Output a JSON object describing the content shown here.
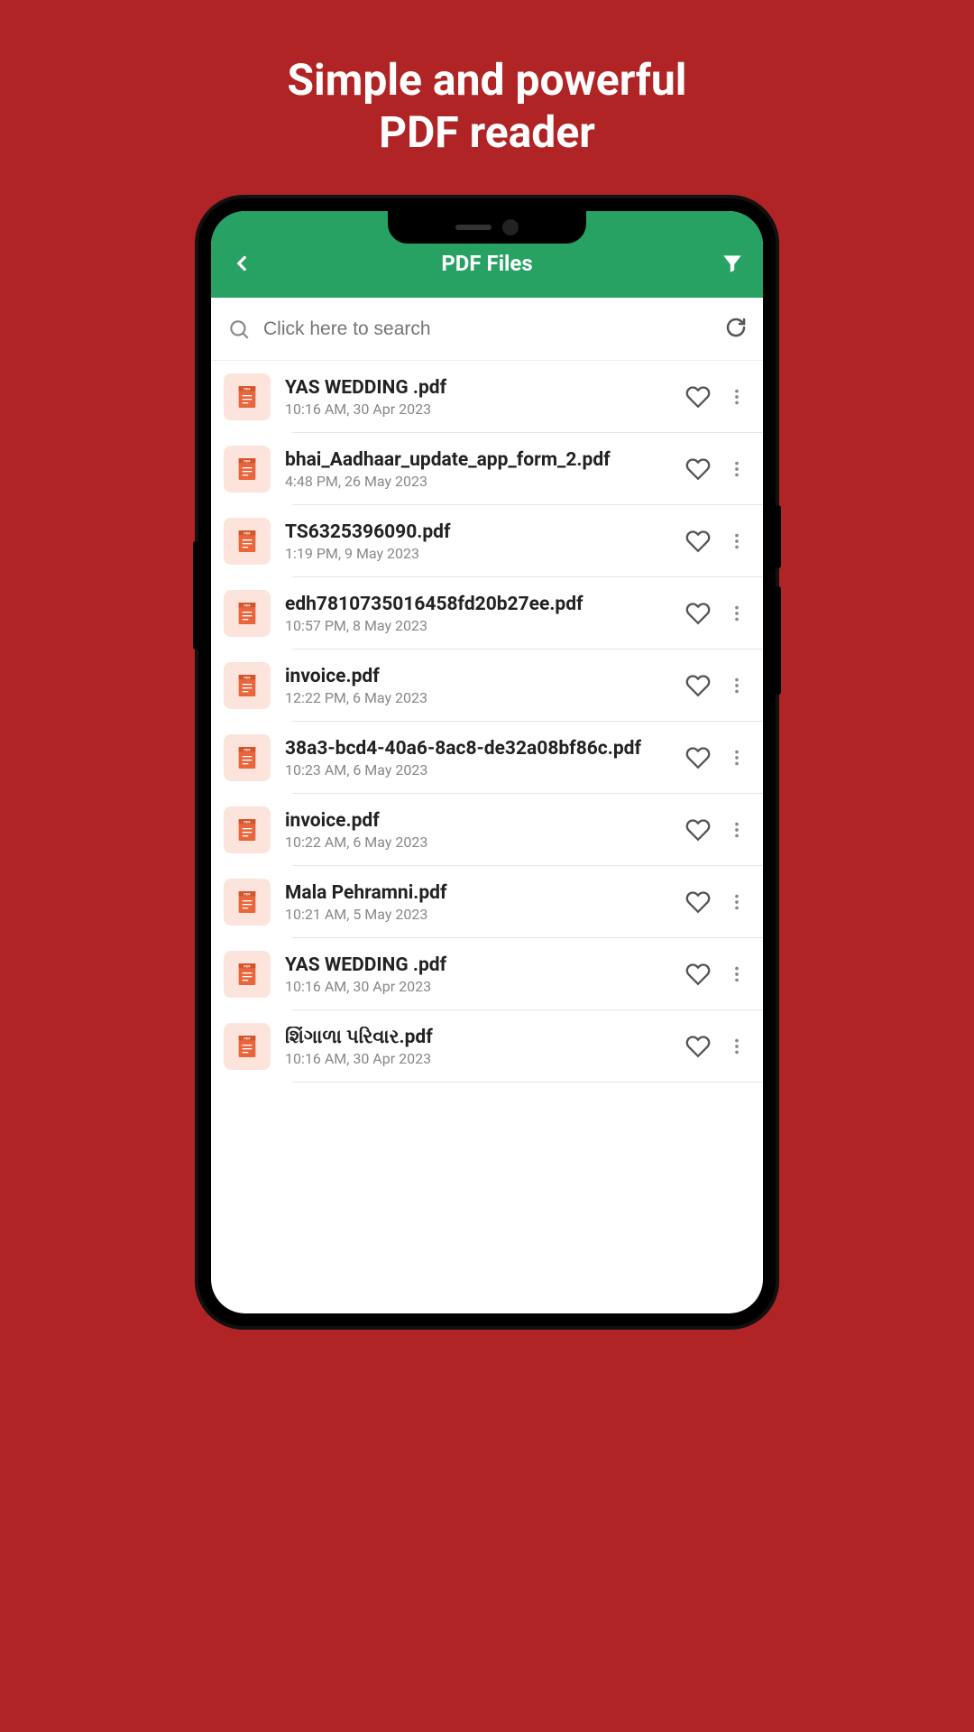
{
  "promo": {
    "line1": "Simple and powerful",
    "line2": "PDF reader"
  },
  "header": {
    "title": "PDF Files"
  },
  "search": {
    "placeholder": "Click here to search"
  },
  "files": [
    {
      "name": "YAS  WEDDING .pdf",
      "date": "10:16 AM, 30 Apr 2023"
    },
    {
      "name": "bhai_Aadhaar_update_app_form_2.pdf",
      "date": "4:48 PM, 26 May 2023"
    },
    {
      "name": "TS6325396090.pdf",
      "date": "1:19 PM, 9 May 2023"
    },
    {
      "name": "edh7810735016458fd20b27ee.pdf",
      "date": "10:57 PM, 8 May 2023"
    },
    {
      "name": "invoice.pdf",
      "date": "12:22 PM, 6 May 2023"
    },
    {
      "name": "38a3-bcd4-40a6-8ac8-de32a08bf86c.pdf",
      "date": "10:23 AM, 6 May 2023"
    },
    {
      "name": "invoice.pdf",
      "date": "10:22 AM, 6 May 2023"
    },
    {
      "name": "Mala Pehramni.pdf",
      "date": "10:21 AM, 5 May 2023"
    },
    {
      "name": "YAS  WEDDING .pdf",
      "date": "10:16 AM, 30 Apr 2023"
    },
    {
      "name": "શિંગાળા પરિવાર.pdf",
      "date": "10:16 AM, 30 Apr 2023"
    }
  ]
}
